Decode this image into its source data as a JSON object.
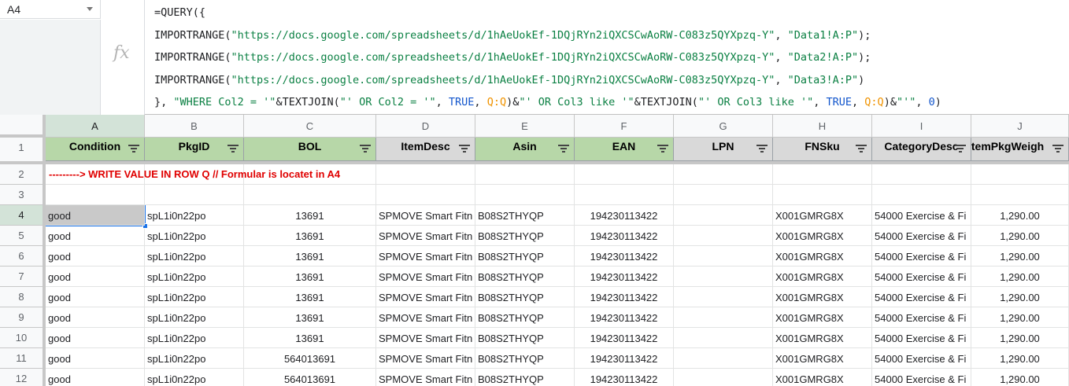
{
  "name_box": {
    "value": "A4"
  },
  "formula_bar": {
    "fx_label": "fx",
    "lines": [
      [
        {
          "t": "=QUERY({",
          "c": "plain"
        }
      ],
      [
        {
          "t": "IMPORTRANGE(",
          "c": "plain"
        },
        {
          "t": "\"https://docs.google.com/spreadsheets/d/1hAeUokEf-1DQjRYn2iQXCSCwAoRW-C083z5QYXpzq-Y\"",
          "c": "str"
        },
        {
          "t": ", ",
          "c": "plain"
        },
        {
          "t": "\"Data1!A:P\"",
          "c": "str"
        },
        {
          "t": ");",
          "c": "plain"
        }
      ],
      [
        {
          "t": "IMPORTRANGE(",
          "c": "plain"
        },
        {
          "t": "\"https://docs.google.com/spreadsheets/d/1hAeUokEf-1DQjRYn2iQXCSCwAoRW-C083z5QYXpzq-Y\"",
          "c": "str"
        },
        {
          "t": ", ",
          "c": "plain"
        },
        {
          "t": "\"Data2!A:P\"",
          "c": "str"
        },
        {
          "t": ");",
          "c": "plain"
        }
      ],
      [
        {
          "t": "IMPORTRANGE(",
          "c": "plain"
        },
        {
          "t": "\"https://docs.google.com/spreadsheets/d/1hAeUokEf-1DQjRYn2iQXCSCwAoRW-C083z5QYXpzq-Y\"",
          "c": "str"
        },
        {
          "t": ", ",
          "c": "plain"
        },
        {
          "t": "\"Data3!A:P\"",
          "c": "str"
        },
        {
          "t": ")",
          "c": "plain"
        }
      ],
      [
        {
          "t": "}, ",
          "c": "plain"
        },
        {
          "t": "\"WHERE Col2 = '\"",
          "c": "str"
        },
        {
          "t": "&TEXTJOIN(",
          "c": "plain"
        },
        {
          "t": "\"' OR Col2 = '\"",
          "c": "str"
        },
        {
          "t": ", ",
          "c": "plain"
        },
        {
          "t": "TRUE",
          "c": "bool"
        },
        {
          "t": ", ",
          "c": "plain"
        },
        {
          "t": "Q:Q",
          "c": "ref"
        },
        {
          "t": ")&",
          "c": "plain"
        },
        {
          "t": "\"' OR Col3 like '\"",
          "c": "str"
        },
        {
          "t": "&TEXTJOIN(",
          "c": "plain"
        },
        {
          "t": "\"' OR Col3 like '\"",
          "c": "str"
        },
        {
          "t": ", ",
          "c": "plain"
        },
        {
          "t": "TRUE",
          "c": "bool"
        },
        {
          "t": ", ",
          "c": "plain"
        },
        {
          "t": "Q:Q",
          "c": "ref"
        },
        {
          "t": ")&",
          "c": "plain"
        },
        {
          "t": "\"'\"",
          "c": "str"
        },
        {
          "t": ", ",
          "c": "plain"
        },
        {
          "t": "0",
          "c": "num"
        },
        {
          "t": ")",
          "c": "plain"
        }
      ]
    ]
  },
  "columns": [
    {
      "letter": "A",
      "header": "Condition",
      "header_bg": "#b7d7a8",
      "align": "left"
    },
    {
      "letter": "B",
      "header": "PkgID",
      "header_bg": "#b7d7a8",
      "align": "left"
    },
    {
      "letter": "C",
      "header": "BOL",
      "header_bg": "#b7d7a8",
      "align": "center"
    },
    {
      "letter": "D",
      "header": "ItemDesc",
      "header_bg": "#d9d9d9",
      "align": "left"
    },
    {
      "letter": "E",
      "header": "Asin",
      "header_bg": "#b7d7a8",
      "align": "left"
    },
    {
      "letter": "F",
      "header": "EAN",
      "header_bg": "#b7d7a8",
      "align": "center"
    },
    {
      "letter": "G",
      "header": "LPN",
      "header_bg": "#d9d9d9",
      "align": "left"
    },
    {
      "letter": "H",
      "header": "FNSku",
      "header_bg": "#d9d9d9",
      "align": "left"
    },
    {
      "letter": "I",
      "header": "CategoryDesc",
      "header_bg": "#d9d9d9",
      "align": "left"
    },
    {
      "letter": "J",
      "header": "itemPkgWeigh",
      "header_bg": "#d9d9d9",
      "align": "center"
    }
  ],
  "row_numbers": [
    "1",
    "2",
    "3",
    "4",
    "5",
    "6",
    "7",
    "8",
    "9",
    "10",
    "11",
    "12"
  ],
  "notice_text": "---------> WRITE VALUE IN ROW Q // Formular is locatet in A4",
  "data_rows": [
    [
      "good",
      "spL1i0n22po",
      "13691",
      "SPMOVE Smart Fitn",
      "B08S2THYQP",
      "194230113422",
      "",
      "X001GMRG8X",
      "54000 Exercise & Fi",
      "1,290.00"
    ],
    [
      "good",
      "spL1i0n22po",
      "13691",
      "SPMOVE Smart Fitn",
      "B08S2THYQP",
      "194230113422",
      "",
      "X001GMRG8X",
      "54000 Exercise & Fi",
      "1,290.00"
    ],
    [
      "good",
      "spL1i0n22po",
      "13691",
      "SPMOVE Smart Fitn",
      "B08S2THYQP",
      "194230113422",
      "",
      "X001GMRG8X",
      "54000 Exercise & Fi",
      "1,290.00"
    ],
    [
      "good",
      "spL1i0n22po",
      "13691",
      "SPMOVE Smart Fitn",
      "B08S2THYQP",
      "194230113422",
      "",
      "X001GMRG8X",
      "54000 Exercise & Fi",
      "1,290.00"
    ],
    [
      "good",
      "spL1i0n22po",
      "13691",
      "SPMOVE Smart Fitn",
      "B08S2THYQP",
      "194230113422",
      "",
      "X001GMRG8X",
      "54000 Exercise & Fi",
      "1,290.00"
    ],
    [
      "good",
      "spL1i0n22po",
      "13691",
      "SPMOVE Smart Fitn",
      "B08S2THYQP",
      "194230113422",
      "",
      "X001GMRG8X",
      "54000 Exercise & Fi",
      "1,290.00"
    ],
    [
      "good",
      "spL1i0n22po",
      "13691",
      "SPMOVE Smart Fitn",
      "B08S2THYQP",
      "194230113422",
      "",
      "X001GMRG8X",
      "54000 Exercise & Fi",
      "1,290.00"
    ],
    [
      "good",
      "spL1i0n22po",
      "564013691",
      "SPMOVE Smart Fitn",
      "B08S2THYQP",
      "194230113422",
      "",
      "X001GMRG8X",
      "54000 Exercise & Fi",
      "1,290.00"
    ],
    [
      "good",
      "spL1i0n22po",
      "564013691",
      "SPMOVE Smart Fitn",
      "B08S2THYQP",
      "194230113422",
      "",
      "X001GMRG8X",
      "54000 Exercise & Fi",
      "1,290.00"
    ]
  ],
  "selected_cell": "A4"
}
